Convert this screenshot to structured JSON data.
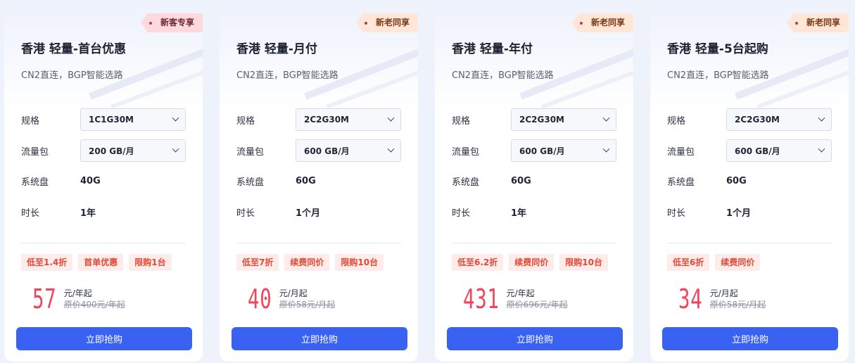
{
  "theme": {
    "accent": "#3a62f2",
    "price_color": "#f4445c",
    "badge_bg": "#fdecea",
    "badge_text": "#e24a37"
  },
  "cards": [
    {
      "tag": "新客专享",
      "title": "香港 轻量-首台优惠",
      "subtitle": "CN2直连，BGP智能选路",
      "spec_label": "规格",
      "spec_value": "1C1G30M",
      "traffic_label": "流量包",
      "traffic_value": "200 GB/月",
      "disk_label": "系统盘",
      "disk_value": "40G",
      "duration_label": "时长",
      "duration_value": "1年",
      "badges": [
        "低至1.4折",
        "首单优惠",
        "限购1台"
      ],
      "price": "57",
      "price_unit": "元/年起",
      "original_price": "原价400元/年起",
      "button": "立即抢购"
    },
    {
      "tag": "新老同享",
      "title": "香港 轻量-月付",
      "subtitle": "CN2直连，BGP智能选路",
      "spec_label": "规格",
      "spec_value": "2C2G30M",
      "traffic_label": "流量包",
      "traffic_value": "600 GB/月",
      "disk_label": "系统盘",
      "disk_value": "60G",
      "duration_label": "时长",
      "duration_value": "1个月",
      "badges": [
        "低至7折",
        "续费同价",
        "限购10台"
      ],
      "price": "40",
      "price_unit": "元/月起",
      "original_price": "原价58元/月起",
      "button": "立即抢购"
    },
    {
      "tag": "新老同享",
      "title": "香港 轻量-年付",
      "subtitle": "CN2直连，BGP智能选路",
      "spec_label": "规格",
      "spec_value": "2C2G30M",
      "traffic_label": "流量包",
      "traffic_value": "600 GB/月",
      "disk_label": "系统盘",
      "disk_value": "60G",
      "duration_label": "时长",
      "duration_value": "1年",
      "badges": [
        "低至6.2折",
        "续费同价",
        "限购10台"
      ],
      "price": "431",
      "price_unit": "元/年起",
      "original_price": "原价696元/年起",
      "button": "立即抢购"
    },
    {
      "tag": "新老同享",
      "title": "香港 轻量-5台起购",
      "subtitle": "CN2直连，BGP智能选路",
      "spec_label": "规格",
      "spec_value": "2C2G30M",
      "traffic_label": "流量包",
      "traffic_value": "600 GB/月",
      "disk_label": "系统盘",
      "disk_value": "60G",
      "duration_label": "时长",
      "duration_value": "1个月",
      "badges": [
        "低至6折",
        "续费同价"
      ],
      "price": "34",
      "price_unit": "元/月起",
      "original_price": "原价58元/月起",
      "button": "立即抢购"
    }
  ]
}
